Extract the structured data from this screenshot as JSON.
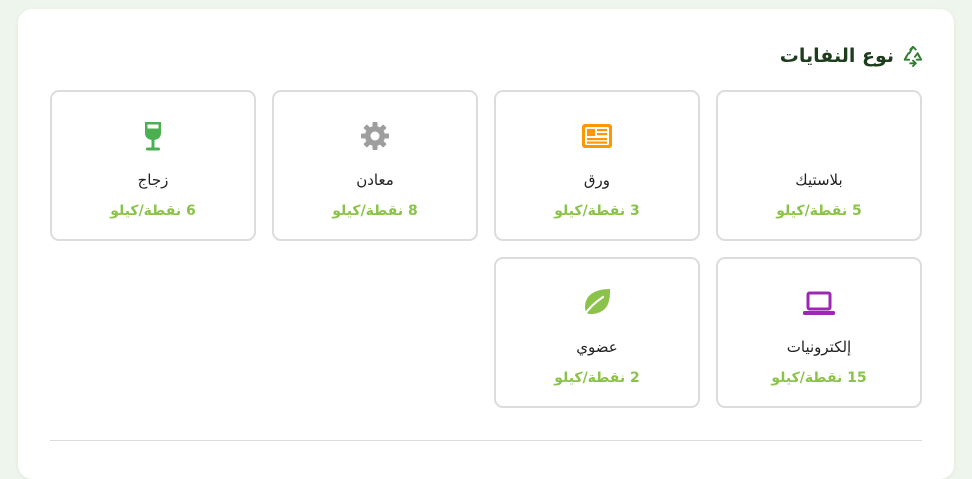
{
  "section": {
    "title": "نوع النفايات",
    "icon": "recycle-icon"
  },
  "waste_types": [
    {
      "name": "بلاستيك",
      "points": "5 نقطة/كيلو",
      "icon": "bottle-icon",
      "color": "#9e9e9e"
    },
    {
      "name": "ورق",
      "points": "3 نقطة/كيلو",
      "icon": "newspaper-icon",
      "color": "#ff9800"
    },
    {
      "name": "معادن",
      "points": "8 نقطة/كيلو",
      "icon": "gear-icon",
      "color": "#9e9e9e"
    },
    {
      "name": "زجاج",
      "points": "6 نقطة/كيلو",
      "icon": "wine-glass-icon",
      "color": "#4caf50"
    },
    {
      "name": "إلكترونيات",
      "points": "15 نقطة/كيلو",
      "icon": "laptop-icon",
      "color": "#9c27b0"
    },
    {
      "name": "عضوي",
      "points": "2 نقطة/كيلو",
      "icon": "leaf-icon",
      "color": "#8bc34a"
    }
  ],
  "colors": {
    "accent": "#8bc34a",
    "title": "#1e3d1e",
    "border": "#dcdcdc"
  }
}
